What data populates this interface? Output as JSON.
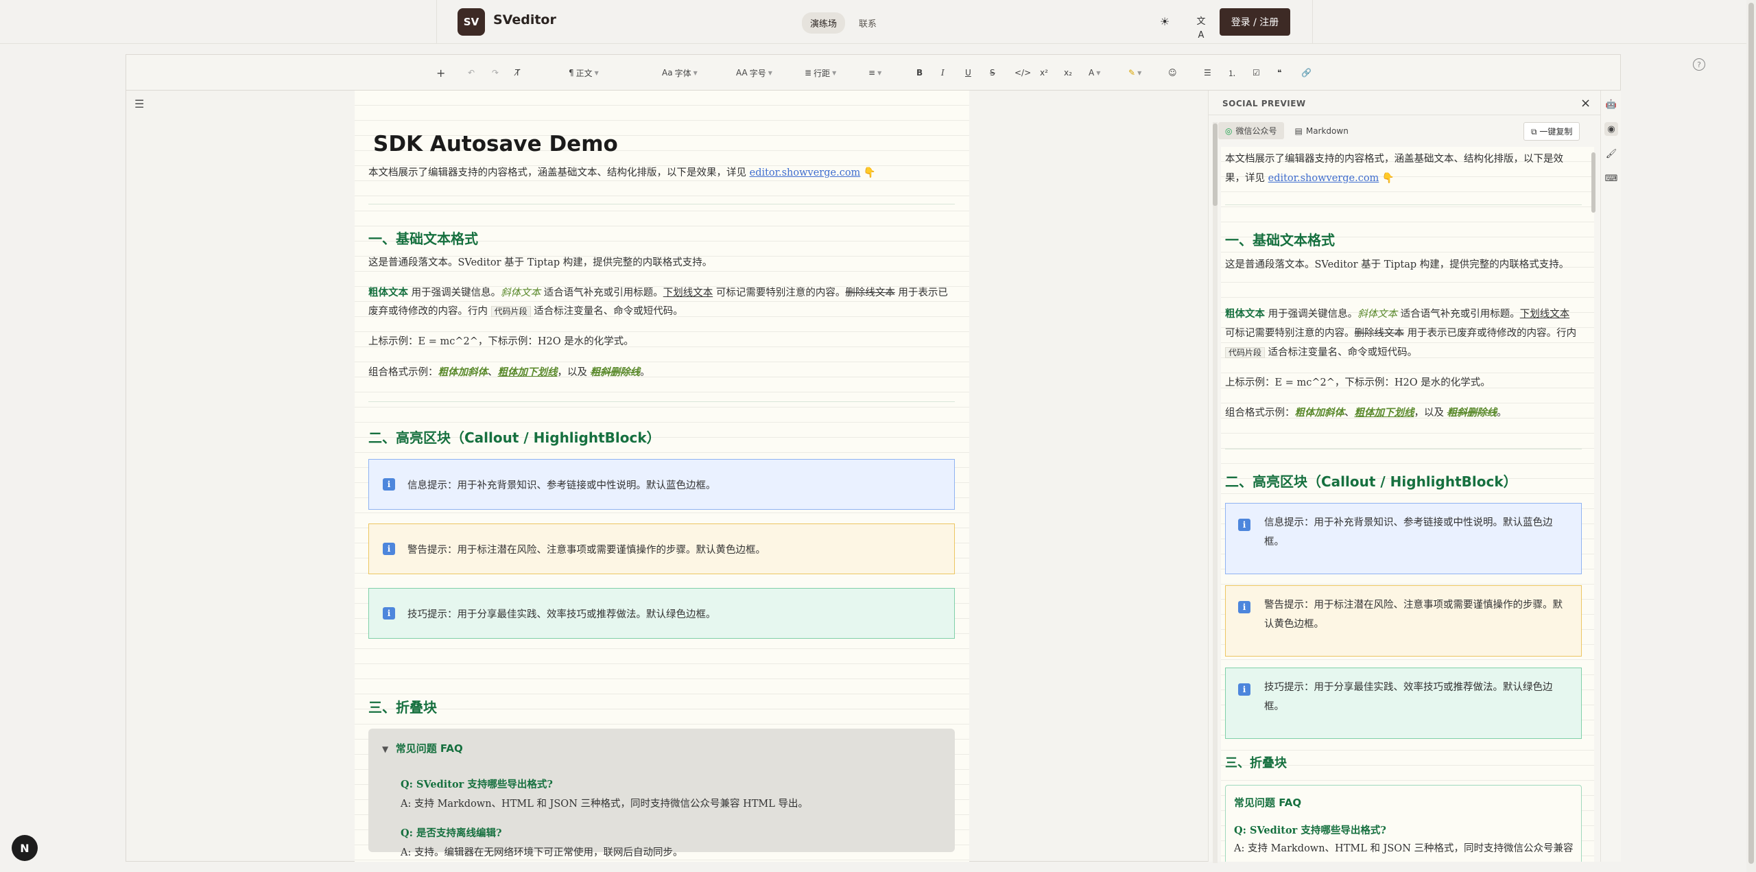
{
  "header": {
    "logo_text": "SV",
    "brand": "SVeditor",
    "nav": [
      "演练场",
      "联系"
    ],
    "login_label": "登录 / 注册"
  },
  "toolbar": {
    "paragraph": "正文",
    "font": "字体",
    "size": "字号",
    "spacing": "行距"
  },
  "doc": {
    "title": "SDK Autosave Demo",
    "intro": "本文档展示了编辑器支持的内容格式，涵盖基础文本、结构化排版，以下是效果，详见 ",
    "intro_link": "editor.showverge.com",
    "intro_emoji": "👇",
    "h2_1": "一、基础文本格式",
    "p1": "这是普通段落文本。SVeditor 基于 Tiptap 构建，提供完整的内联格式支持。",
    "p2": {
      "bold": "粗体文本",
      "t1": " 用于强调关键信息。",
      "italic": "斜体文本",
      "t2": " 适合语气补充或引用标题。",
      "underline": "下划线文本",
      "t3": " 可标记需要特别注意的内容。",
      "strike": "删除线文本",
      "t4": " 用于表示已废弃或待修改的内容。行内 ",
      "code": "代码片段",
      "t5": " 适合标注变量名、命令或短代码。"
    },
    "p3": "上标示例：E = mc^2^，下标示例：H2O 是水的化学式。",
    "p4": {
      "t1": "组合格式示例：",
      "c1": "粗体加斜体",
      "sep1": "、",
      "c2": "粗体加下划线",
      "t2": "，以及 ",
      "c3": "粗斜删除线",
      "t3": "。"
    },
    "h2_2": "二、高亮区块（Callout / HighlightBlock）",
    "callout_info": "信息提示：用于补充背景知识、参考链接或中性说明。默认蓝色边框。",
    "callout_warn": "警告提示：用于标注潜在风险、注意事项或需要谨慎操作的步骤。默认黄色边框。",
    "callout_tip": "技巧提示：用于分享最佳实践、效率技巧或推荐做法。默认绿色边框。",
    "h2_3": "三、折叠块",
    "faq_title": "常见问题 FAQ",
    "faq": [
      {
        "q": "Q: SVeditor 支持哪些导出格式?",
        "a": "A: 支持 Markdown、HTML 和 JSON 三种格式，同时支持微信公众号兼容 HTML 导出。"
      },
      {
        "q": "Q: 是否支持离线编辑?",
        "a": "A: 支持。编辑器在无网络环境下可正常使用，联网后自动同步。"
      }
    ]
  },
  "preview": {
    "title": "SOCIAL PREVIEW",
    "tab_wechat": "微信公众号",
    "tab_markdown": "Markdown",
    "copy_label": "一键复制",
    "faq_title": "常见问题 FAQ",
    "faq_q1": "Q: SVeditor 支持哪些导出格式?",
    "faq_a1": "A: 支持 Markdown、HTML 和 JSON 三种格式，同时支持微信公众号兼容"
  },
  "devtools_label": "N",
  "colors": {
    "brand": "#3d2a25",
    "heading": "#16703f",
    "link": "#3f6dcf"
  }
}
